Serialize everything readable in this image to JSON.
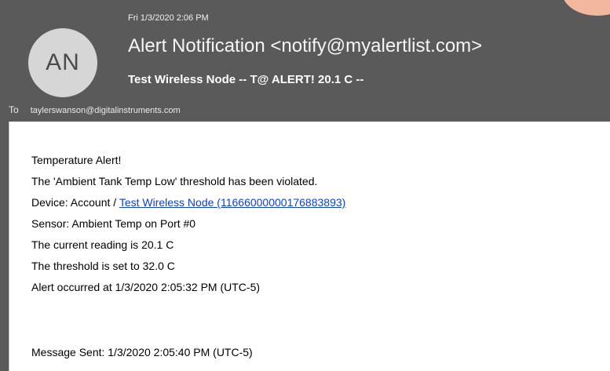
{
  "email": {
    "date": "Fri 1/3/2020 2:06 PM",
    "avatar_initials": "AN",
    "sender": "Alert Notification <notify@myalertlist.com>",
    "subject": "Test Wireless Node -- T@ ALERT! 20.1 C --",
    "to_label": "To",
    "to_address": "taylerswanson@digitalinstruments.com"
  },
  "body": {
    "line1": "Temperature Alert!",
    "line2": "The 'Ambient Tank Temp Low' threshold has been violated.",
    "line3_prefix": "Device: Account / ",
    "line3_link": "Test Wireless Node (11666000000176883893)",
    "line4": "Sensor: Ambient Temp on Port #0",
    "line5": "The current reading is 20.1 C",
    "line6": "The threshold is set to 32.0 C",
    "line7": "Alert occurred at 1/3/2020 2:05:32 PM (UTC-5)",
    "line8": "Message Sent: 1/3/2020 2:05:40 PM (UTC-5)"
  },
  "colors": {
    "header_bg": "#5a5a5a",
    "link": "#0b3fd6",
    "accent": "#f2b79c"
  }
}
